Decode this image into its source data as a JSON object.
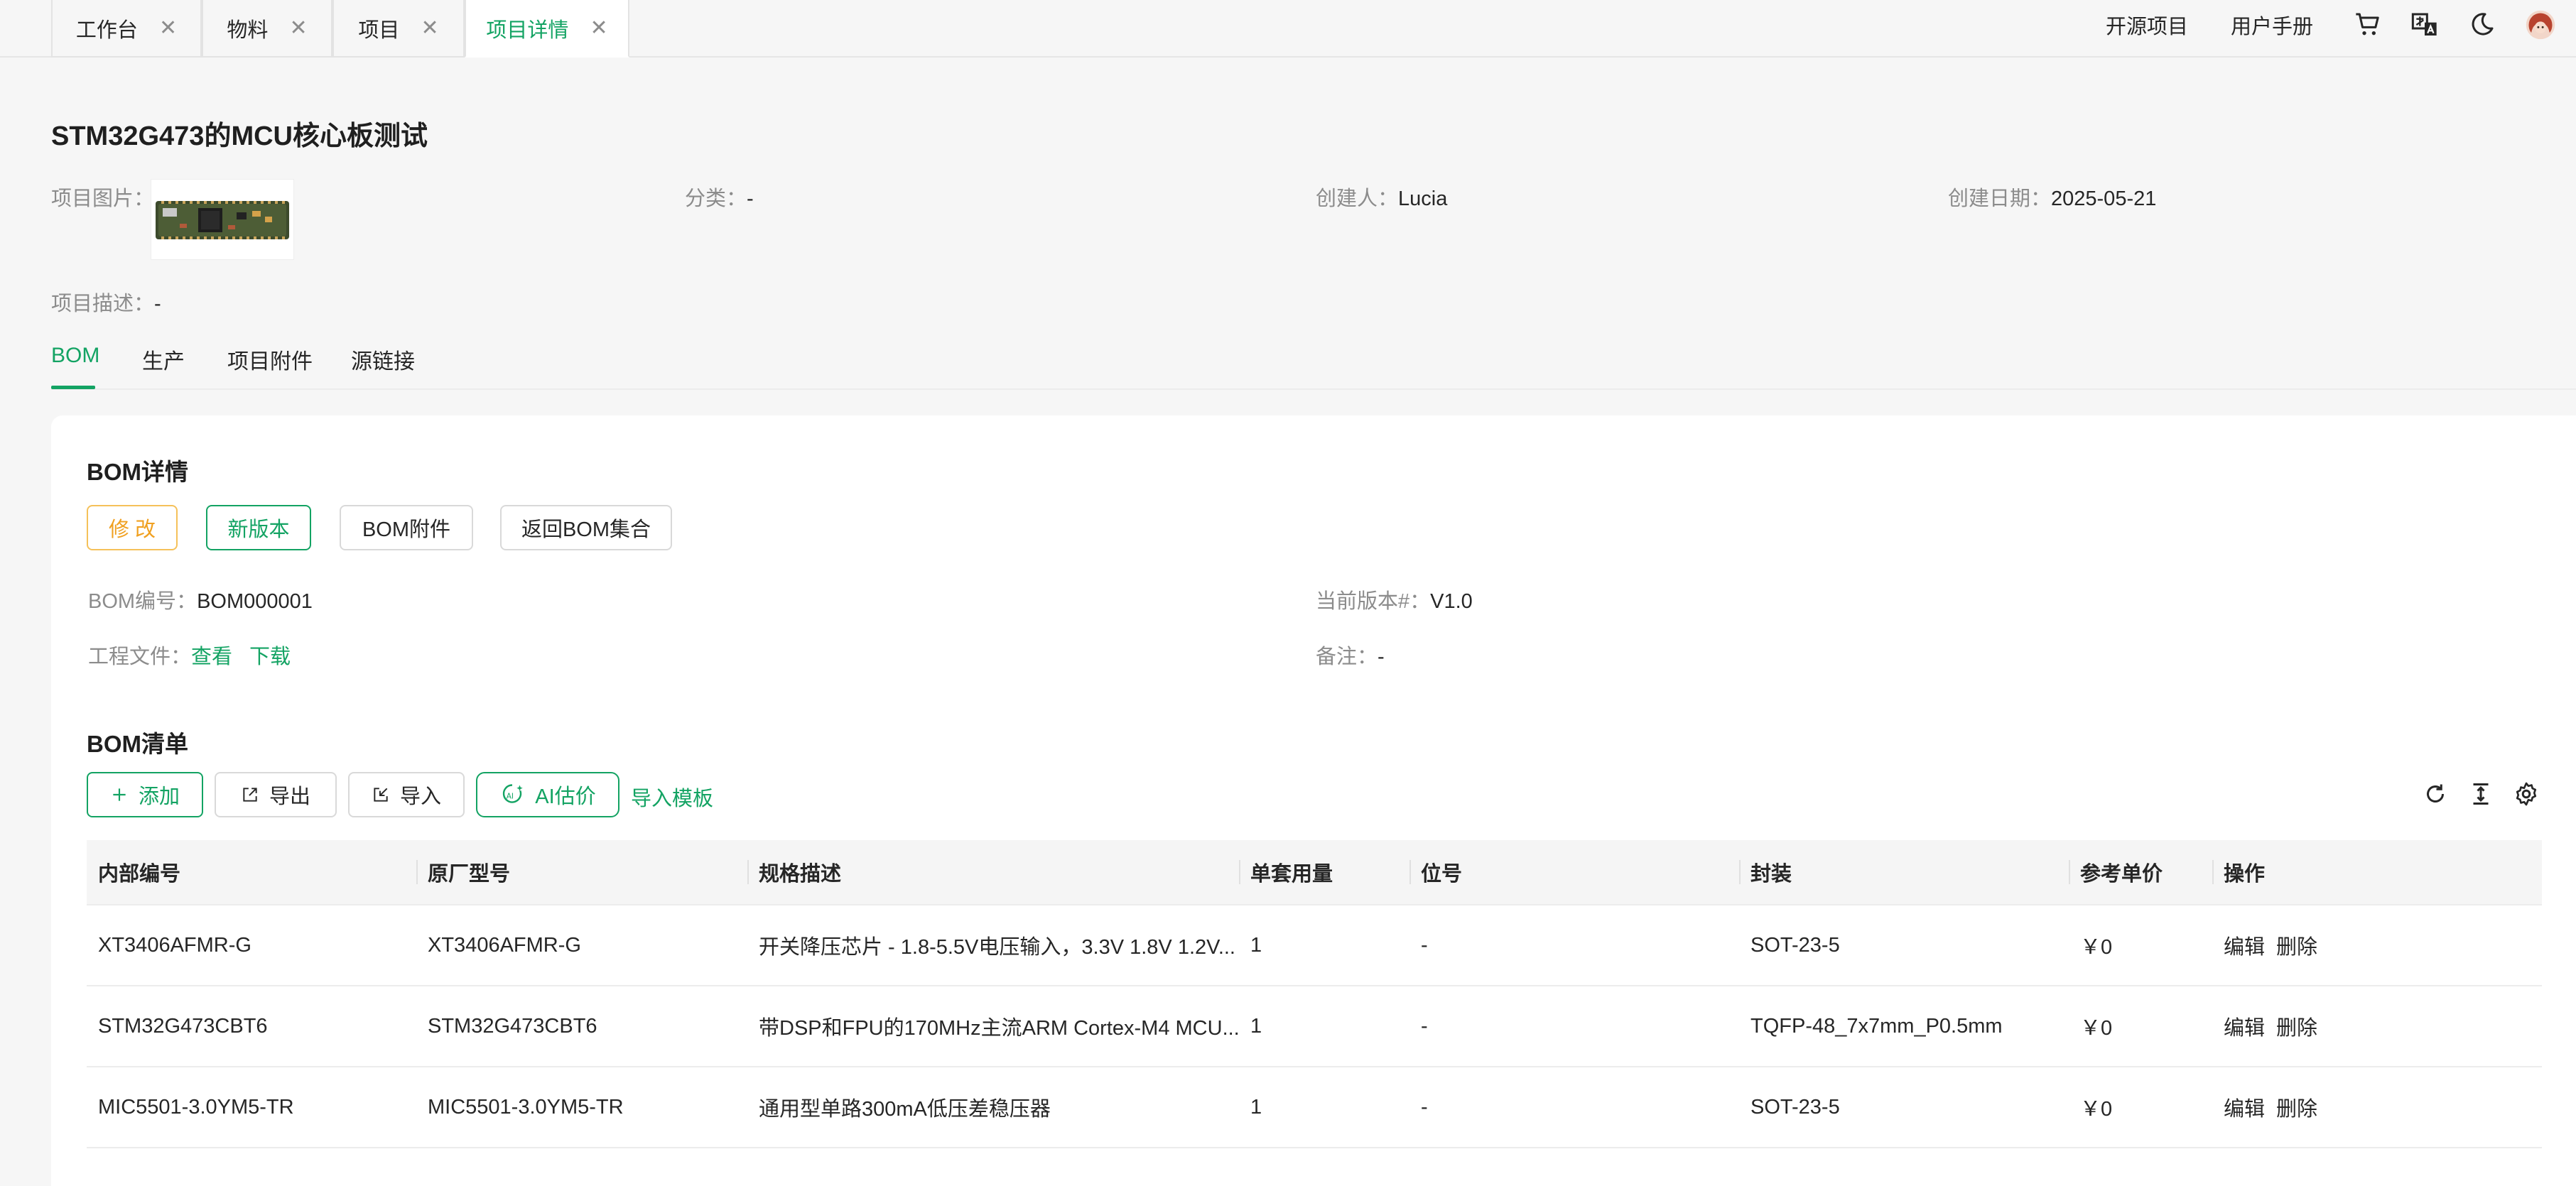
{
  "tabs": [
    {
      "label": "工作台",
      "closable": true,
      "active": false
    },
    {
      "label": "物料",
      "closable": true,
      "active": false
    },
    {
      "label": "项目",
      "closable": true,
      "active": false
    },
    {
      "label": "项目详情",
      "closable": true,
      "active": true
    }
  ],
  "topnav": {
    "open_source": "开源项目",
    "manual": "用户手册",
    "icons": [
      "cart-icon",
      "translate-icon",
      "dark-mode-icon",
      "avatar"
    ]
  },
  "project": {
    "title": "STM32G473的MCU核心板测试",
    "image_label": "项目图片：",
    "category_label": "分类：",
    "category_value": "-",
    "creator_label": "创建人：",
    "creator_value": "Lucia",
    "created_label": "创建日期：",
    "created_value": "2025-05-21",
    "desc_label": "项目描述：",
    "desc_value": "-"
  },
  "subtabs": [
    "BOM",
    "生产",
    "项目附件",
    "源链接"
  ],
  "bom_detail": {
    "title": "BOM详情",
    "buttons": {
      "edit": "修 改",
      "new_version": "新版本",
      "attachments": "BOM附件",
      "back": "返回BOM集合"
    },
    "code_label": "BOM编号：",
    "code_value": "BOM000001",
    "version_label": "当前版本#：",
    "version_value": "V1.0",
    "files_label": "工程文件：",
    "files_view": "查看",
    "files_download": "下载",
    "remark_label": "备注：",
    "remark_value": "-"
  },
  "bom_list": {
    "title": "BOM清单",
    "buttons": {
      "add": "添加",
      "export": "导出",
      "import": "导入",
      "ai": "AI估价",
      "template": "导入模板"
    },
    "columns": [
      "内部编号",
      "原厂型号",
      "规格描述",
      "单套用量",
      "位号",
      "封装",
      "参考单价",
      "操作"
    ],
    "rows": [
      {
        "internal": "XT3406AFMR-G",
        "model": "XT3406AFMR-G",
        "desc": "开关降压芯片 - 1.8-5.5V电压输入，3.3V 1.8V 1.2V...",
        "qty": "1",
        "ref": "-",
        "package": "SOT-23-5",
        "price": "￥0"
      },
      {
        "internal": "STM32G473CBT6",
        "model": "STM32G473CBT6",
        "desc": "带DSP和FPU的170MHz主流ARM Cortex-M4 MCU...",
        "qty": "1",
        "ref": "-",
        "package": "TQFP-48_7x7mm_P0.5mm",
        "price": "￥0"
      },
      {
        "internal": "MIC5501-3.0YM5-TR",
        "model": "MIC5501-3.0YM5-TR",
        "desc": "通用型单路300mA低压差稳压器",
        "qty": "1",
        "ref": "-",
        "package": "SOT-23-5",
        "price": "￥0"
      }
    ],
    "actions": {
      "edit": "编辑",
      "delete": "删除"
    }
  },
  "colors": {
    "accent": "#13a363",
    "warning": "#f0a020",
    "danger": "#f0545c"
  }
}
